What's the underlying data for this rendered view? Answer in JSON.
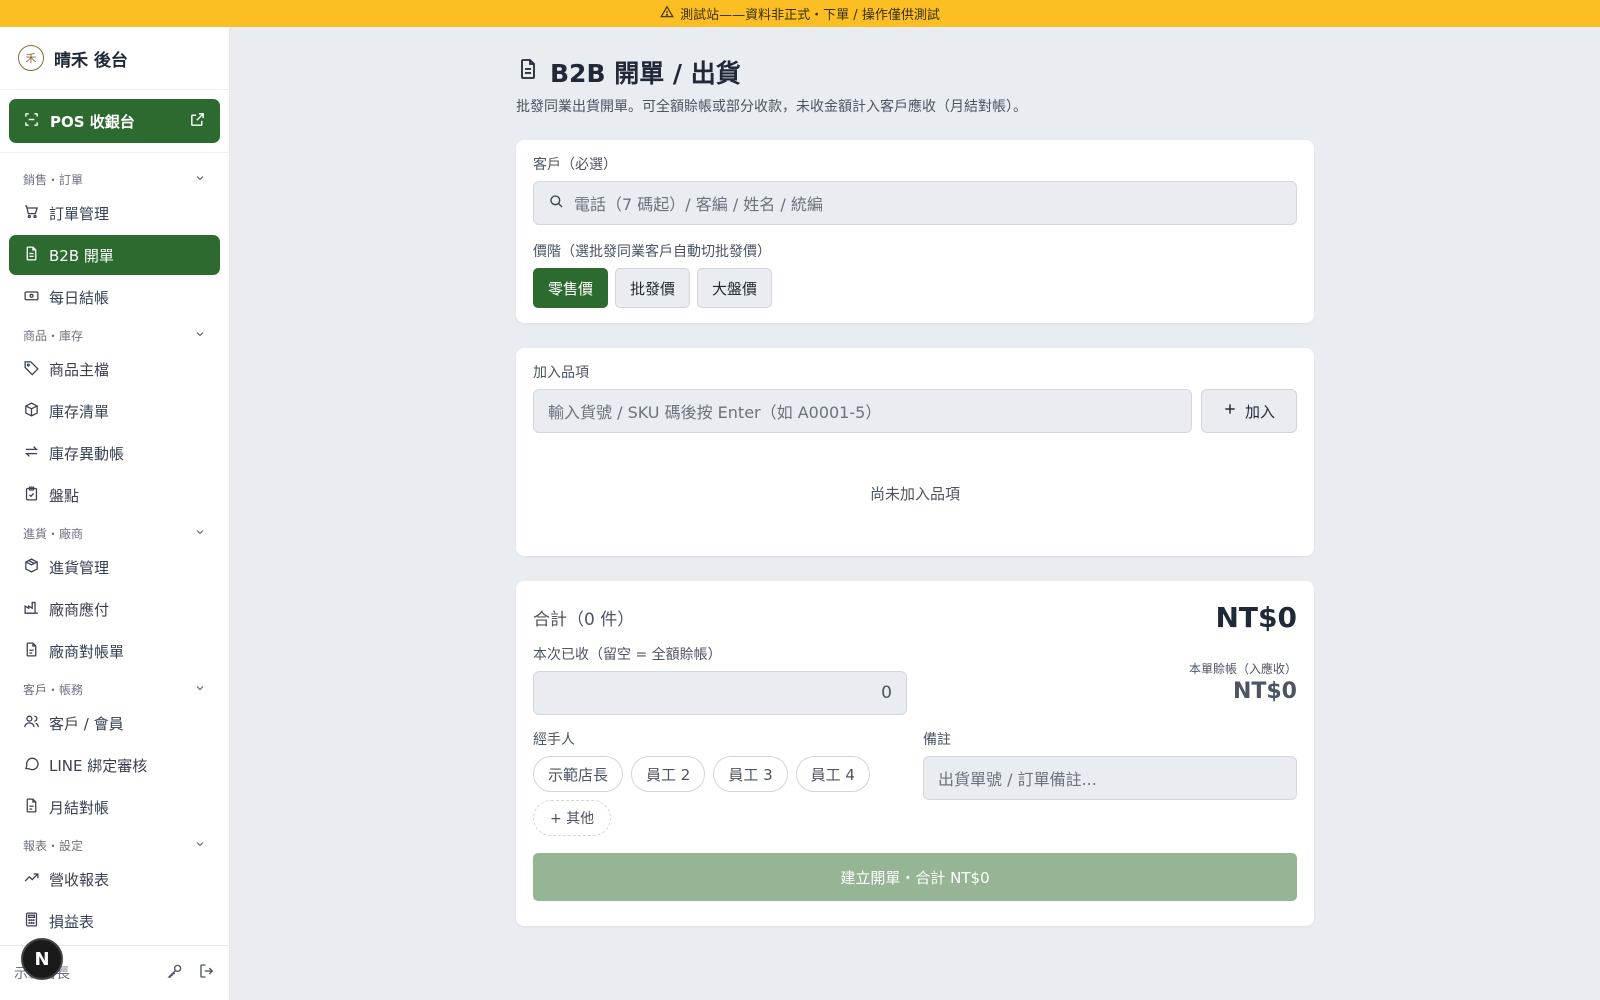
{
  "banner": {
    "text": "測試站——資料非正式・下單 / 操作僅供測試"
  },
  "brand": {
    "logo_char": "禾",
    "name": "晴禾 後台"
  },
  "pos_button": {
    "label": "POS 收銀台"
  },
  "nav": {
    "groups": [
      {
        "label": "銷售・訂單",
        "items": [
          {
            "label": "訂單管理",
            "icon": "cart-icon"
          },
          {
            "label": "B2B 開單",
            "icon": "document-icon",
            "active": true
          },
          {
            "label": "每日結帳",
            "icon": "cash-icon"
          }
        ]
      },
      {
        "label": "商品・庫存",
        "items": [
          {
            "label": "商品主檔",
            "icon": "tag-icon"
          },
          {
            "label": "庫存清單",
            "icon": "box-icon"
          },
          {
            "label": "庫存異動帳",
            "icon": "transfer-icon"
          },
          {
            "label": "盤點",
            "icon": "clipboard-icon"
          }
        ]
      },
      {
        "label": "進貨・廠商",
        "items": [
          {
            "label": "進貨管理",
            "icon": "package-icon"
          },
          {
            "label": "廠商應付",
            "icon": "factory-icon"
          },
          {
            "label": "廠商對帳單",
            "icon": "receipt-icon"
          }
        ]
      },
      {
        "label": "客戶・帳務",
        "items": [
          {
            "label": "客戶 / 會員",
            "icon": "users-icon"
          },
          {
            "label": "LINE 綁定審核",
            "icon": "chat-icon"
          },
          {
            "label": "月結對帳",
            "icon": "receipt-icon"
          }
        ]
      },
      {
        "label": "報表・設定",
        "items": [
          {
            "label": "營收報表",
            "icon": "trend-icon"
          },
          {
            "label": "損益表",
            "icon": "calculator-icon"
          }
        ]
      }
    ]
  },
  "user": {
    "name": "示範店長",
    "badge": "N"
  },
  "page": {
    "title": "B2B 開單 / 出貨",
    "subtitle": "批發同業出貨開單。可全額賒帳或部分收款，未收金額計入客戶應收（月結對帳）。"
  },
  "customer": {
    "label": "客戶（必選）",
    "placeholder": "電話（7 碼起）/ 客編 / 姓名 / 統編",
    "tier_label": "價階（選批發同業客戶自動切批發價）",
    "tiers": [
      "零售價",
      "批發價",
      "大盤價"
    ],
    "selected_tier": "零售價"
  },
  "items": {
    "label": "加入品項",
    "placeholder": "輸入貨號 / SKU 碼後按 Enter（如 A0001-5）",
    "add_label": "加入",
    "empty_text": "尚未加入品項"
  },
  "summary": {
    "total_label": "合計（0 件）",
    "total_amount": "NT$0",
    "paid_label": "本次已收（留空 = 全額賒帳）",
    "paid_value": "0",
    "credit_label": "本單賒帳（入應收）",
    "credit_amount": "NT$0",
    "handler_label": "經手人",
    "handlers": [
      "示範店長",
      "員工 2",
      "員工 3",
      "員工 4"
    ],
    "other_label": "+ 其他",
    "note_label": "備註",
    "note_placeholder": "出貨單號 / 訂單備註...",
    "submit_label": "建立開單・合計 NT$0"
  },
  "colors": {
    "accent": "#2d6a2f",
    "banner": "#fbbf24",
    "submit_disabled": "#95b595"
  }
}
